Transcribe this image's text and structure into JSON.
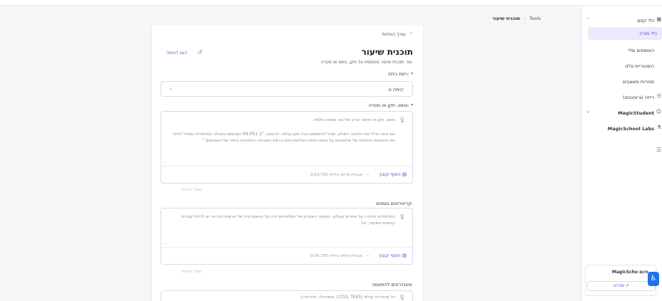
{
  "sidebar": {
    "items": [
      {
        "label": "כלי קסם",
        "icon": "grid-icon",
        "chevron": "^"
      },
      {
        "label": "כלי מורה",
        "active": true
      },
      {
        "label": "האוספים שלי"
      },
      {
        "label": "היסטוריית פלט"
      },
      {
        "label": "ספריית משאבים"
      },
      {
        "label": "רייזה (צ'אטבוט)",
        "icon": "chat-icon"
      },
      {
        "label": "MagicStudent",
        "icon": "student-icon",
        "chevron": "v"
      },
      {
        "label": "MagicSchool Labs",
        "icon": "flask-icon"
      }
    ],
    "promo": {
      "text": "MagicScho חינם",
      "button": "שדרגו"
    }
  },
  "breadcrumb": {
    "root": "Tools",
    "current": "תוכנית שיעור"
  },
  "panel": {
    "editor_label": "עורך הנחיות",
    "title": "תוכנית שיעור",
    "subtitle": "צור תוכנית שיעור מבוססת על תקן, נושא או מטרה.",
    "demo_label": "הצג דוגמה",
    "grade": {
      "label": "רמת כיתה: *",
      "value": "כיתה ט'"
    },
    "topic": {
      "label": "נושא, תקן או מטרה: *",
      "placeholder_line1": "נושא, תקן או תיאור ארוך של מה שאתה מלמד.",
      "placeholder_line2": "אם אתה כולל את התיאור המלא, תוכל להשתמש בכל תקן עולמי. לדוגמה, \"HS-PS1-1 השתמש בטבלה המחזורית כמודל לחיזוי את התכונות היחסיות של אלמנטים על בסיס דפוסי האלקטרונים ברמת האנרגיה החיצונית ביותר של האטומים.\"",
      "add_label": "הוסף קובץ",
      "count": "0/24,750 מגבלת מילים כוללת",
      "hint": "שמור הנחייה"
    },
    "criteria": {
      "label": "קריטריונים נוספים:",
      "placeholder": "התלמידים ביחידה על אזורים בעולם. השיעור האחרון של התלמידים היה על הגיאוגרפיה של ארצות הברית. יש לכלול עבודת קבוצות בשיעור, וכו'.",
      "add_label": "הוסף קובץ",
      "count": "0/24,750 מגבלת מילים כוללת",
      "hint": "שמור הנחייה"
    },
    "standards": {
      "label": "סטנדרטים להתאמה:",
      "placeholder": "כל סטנדרט עולמי (CCSS, TEKS, אוסטרלי, פלורידה)"
    }
  }
}
